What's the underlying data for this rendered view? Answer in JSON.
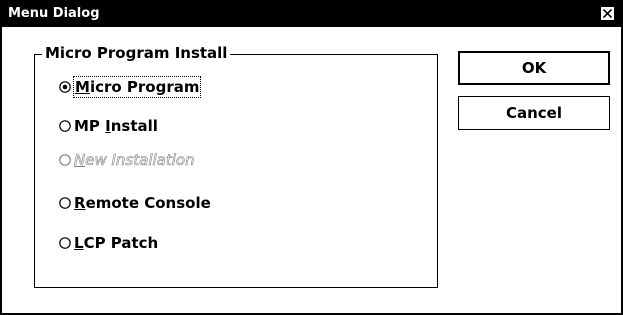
{
  "window": {
    "title": "Menu Dialog",
    "close_label": "×"
  },
  "group": {
    "legend": "Micro Program Install",
    "options": [
      {
        "label_before": "",
        "mnemonic": "M",
        "label_after": "icro Program",
        "selected": true,
        "enabled": true
      },
      {
        "label_before": "MP ",
        "mnemonic": "I",
        "label_after": "nstall",
        "selected": false,
        "enabled": true
      },
      {
        "label_before": "",
        "mnemonic": "N",
        "label_after": "ew Installation",
        "selected": false,
        "enabled": false
      },
      {
        "label_before": "",
        "mnemonic": "R",
        "label_after": "emote Console",
        "selected": false,
        "enabled": true
      },
      {
        "label_before": "",
        "mnemonic": "L",
        "label_after": "CP Patch",
        "selected": false,
        "enabled": true
      }
    ]
  },
  "buttons": {
    "ok_label": "OK",
    "cancel_label": "Cancel"
  },
  "colors": {
    "titlebar_bg": "#000000",
    "titlebar_text": "#ffffff",
    "disabled_text": "#808080"
  }
}
